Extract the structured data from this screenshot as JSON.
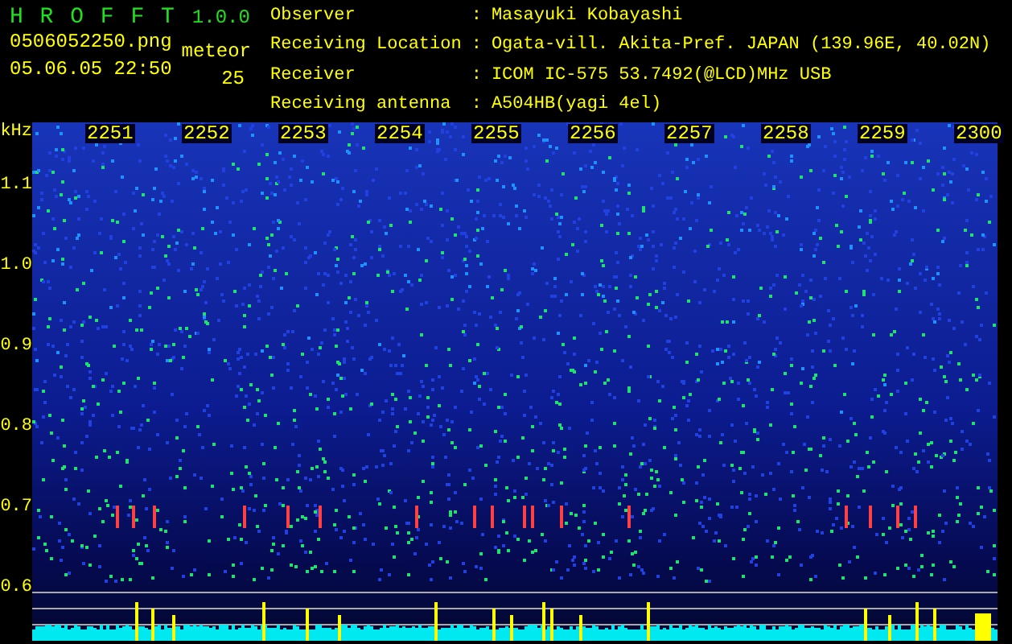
{
  "app": {
    "name": "H R O F F T",
    "version": "1.0.0"
  },
  "file": "0506052250.png",
  "datetime": "05.06.05 22:50",
  "meteor": {
    "label": "meteor",
    "count": "25"
  },
  "info": [
    {
      "label": "Observer",
      "separator": ":",
      "value": "Masayuki Kobayashi"
    },
    {
      "label": "Receiving Location",
      "separator": ":",
      "value": "Ogata-vill. Akita-Pref. JAPAN (139.96E, 40.02N)"
    },
    {
      "label": "Receiver",
      "separator": ":",
      "value": "ICOM IC-575 53.7492(@LCD)MHz USB"
    },
    {
      "label": "Receiving antenna",
      "separator": ":",
      "value": "A504HB(yagi 4el)"
    }
  ],
  "axis": {
    "unit": "kHz",
    "ticks": [
      "1.1",
      "1.0",
      "0.9",
      "0.8",
      "0.7",
      "0.6"
    ]
  },
  "time_labels": [
    "2251",
    "2252",
    "2253",
    "2254",
    "2255",
    "2256",
    "2257",
    "2258",
    "2259",
    "2300"
  ]
}
